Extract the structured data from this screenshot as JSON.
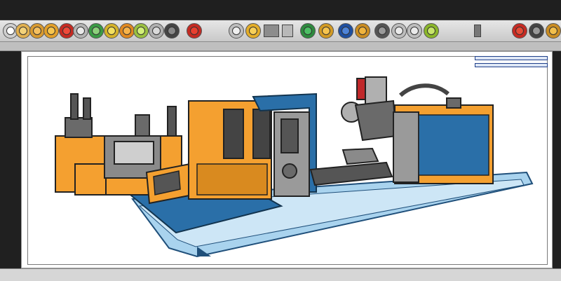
{
  "menu": {
    "items": [
      "",
      "",
      "",
      "",
      "",
      "",
      "",
      ""
    ]
  },
  "toolbar": {
    "buttons": [
      {
        "icon": "gear-icon",
        "color": "#f0a020"
      },
      {
        "icon": "record-icon",
        "color": "#d02020"
      },
      {
        "icon": "sync-icon",
        "color": "#3aa040"
      },
      {
        "icon": "target-icon",
        "color": "#2070c0"
      }
    ],
    "layer_box": {
      "icon": "layer-icon",
      "color": "#8c8c8c"
    }
  },
  "subbar": {
    "labels": [
      "",
      "",
      "",
      ""
    ]
  },
  "properties": {
    "fields": [
      "",
      ""
    ],
    "labels": [
      "",
      ""
    ]
  },
  "status": {
    "left": "",
    "right": ""
  },
  "colors": {
    "machine_orange": "#f4a030",
    "machine_blue": "#2a6fa8",
    "machine_gray": "#6a6a6a",
    "conveyor_light": "#a9d3ee",
    "accent_red": "#c0282a"
  }
}
